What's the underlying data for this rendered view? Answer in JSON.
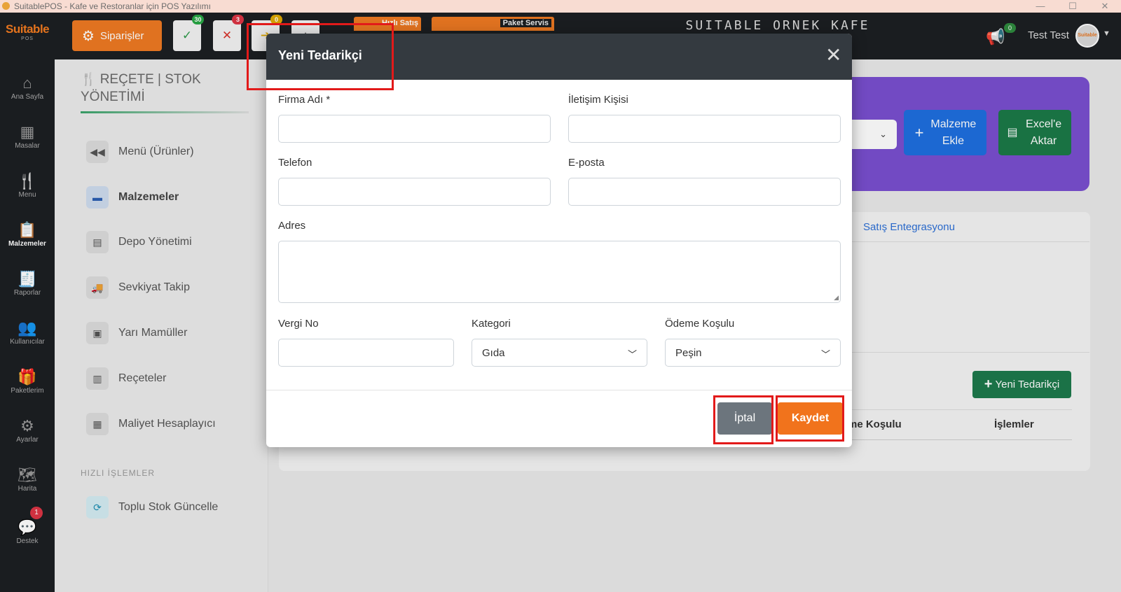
{
  "window": {
    "title": "SuitablePOS - Kafe ve Restoranlar için POS Yazılımı",
    "controls": {
      "minimize": "—",
      "maximize": "☐",
      "close": "✕"
    }
  },
  "topbar": {
    "brand": "Suitable",
    "brand_sub": "POS",
    "orders_label": "Siparişler",
    "quick_buttons": [
      {
        "icon": "check-icon",
        "glyph": "✓",
        "badge": "30",
        "badge_color": "#28a745",
        "color": "#2e9b4a"
      },
      {
        "icon": "x-icon",
        "glyph": "✕",
        "badge": "3",
        "badge_color": "#dc3545",
        "color": "#d9342b"
      },
      {
        "icon": "arrow-icon",
        "glyph": "➔",
        "badge": "0",
        "badge_color": "#e0a800",
        "color": "#e0a800"
      },
      {
        "icon": "box-icon",
        "glyph": "▲",
        "badge": "",
        "badge_color": "#555",
        "color": "#555"
      }
    ],
    "hizli_satis_label": "Hızlı Satış",
    "paket_servis_label": "Paket Servis",
    "shop_name": "SUITABLE ORNEK KAFE",
    "notifications_badge": "0",
    "user_name": "Test Test",
    "avatar_text": "Suitable"
  },
  "sidebar": {
    "items": [
      {
        "label": "Ana Sayfa",
        "icon": "home-icon",
        "glyph": "⌂"
      },
      {
        "label": "Masalar",
        "icon": "table-grid-icon",
        "glyph": "▦"
      },
      {
        "label": "Menu",
        "icon": "utensils-icon",
        "glyph": "🍴"
      },
      {
        "label": "Malzemeler",
        "icon": "clipboard-icon",
        "glyph": "📋"
      },
      {
        "label": "Raporlar",
        "icon": "receipt-icon",
        "glyph": "🧾"
      },
      {
        "label": "Kullanıcılar",
        "icon": "users-icon",
        "glyph": "👥"
      },
      {
        "label": "Paketlerim",
        "icon": "gift-icon",
        "glyph": "🎁"
      },
      {
        "label": "Ayarlar",
        "icon": "gears-icon",
        "glyph": "⚙"
      },
      {
        "label": "Harita",
        "icon": "map-icon",
        "glyph": "🗺"
      },
      {
        "label": "Destek",
        "icon": "chat-icon",
        "glyph": "💬",
        "badge": "1"
      }
    ]
  },
  "left_panel": {
    "title": "REÇETE | STOK YÖNETİMİ",
    "items": [
      {
        "label": "Menü (Ürünler)",
        "icon": "backward-icon",
        "glyph": "◀◀"
      },
      {
        "label": "Malzemeler",
        "icon": "box-icon",
        "glyph": "▬"
      },
      {
        "label": "Depo Yönetimi",
        "icon": "warehouse-icon",
        "glyph": "▤"
      },
      {
        "label": "Sevkiyat Takip",
        "icon": "truck-icon",
        "glyph": "🚚"
      },
      {
        "label": "Yarı Mamüller",
        "icon": "boxes-icon",
        "glyph": "▣"
      },
      {
        "label": "Reçeteler",
        "icon": "receipt-icon",
        "glyph": "▥"
      },
      {
        "label": "Maliyet Hesaplayıcı",
        "icon": "calculator-icon",
        "glyph": "▦"
      }
    ],
    "quick_title": "HIZLI İŞLEMLER",
    "quick_items": [
      {
        "label": "Toplu Stok Güncelle",
        "icon": "sync-icon",
        "glyph": "⟳"
      }
    ]
  },
  "main": {
    "add_material_label": "Malzeme Ekle",
    "export_excel_label": "Excel'e Aktar",
    "tab_sales_integration": "Satış Entegrasyonu",
    "new_supplier_label": "Yeni Tedarikçi",
    "table_headers": [
      "me Koşulu",
      "İşlemler"
    ]
  },
  "modal": {
    "title": "Yeni Tedarikçi",
    "fields": {
      "firma_adi": {
        "label": "Firma Adı *",
        "value": ""
      },
      "iletisim_kisisi": {
        "label": "İletişim Kişisi",
        "value": ""
      },
      "telefon": {
        "label": "Telefon",
        "value": ""
      },
      "eposta": {
        "label": "E-posta",
        "value": ""
      },
      "adres": {
        "label": "Adres",
        "value": ""
      },
      "vergi_no": {
        "label": "Vergi No",
        "value": ""
      },
      "kategori": {
        "label": "Kategori",
        "value": "Gıda"
      },
      "odeme_kosulu": {
        "label": "Ödeme Koşulu",
        "value": "Peşin"
      }
    },
    "cancel_label": "İptal",
    "save_label": "Kaydet"
  },
  "colors": {
    "accent": "#f1731c",
    "dark": "#343a40",
    "purple_header": "#7a4fd0",
    "highlight_box": "#e21a1a"
  }
}
